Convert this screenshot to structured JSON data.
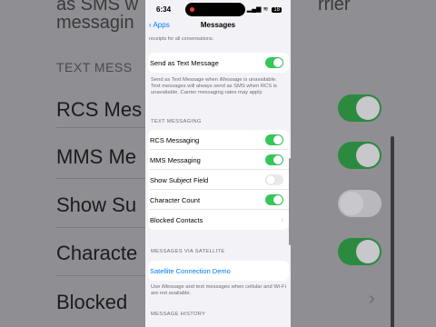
{
  "status_bar": {
    "time": "6:34",
    "signal": "▂▄▆",
    "wifi": "≋",
    "battery": "18"
  },
  "nav": {
    "back_label": "Apps",
    "title": "Messages"
  },
  "top_note": "receipts for all conversations.",
  "send_as_text": {
    "label": "Send as Text Message",
    "on": true
  },
  "send_as_text_footnote": "Send as Text Message when iMessage is unavailable. Text messages will always send as SMS when RCS is unavailable. Carrier messaging rates may apply.",
  "text_messaging_header": "TEXT MESSAGING",
  "text_messaging_rows": [
    {
      "label": "RCS Messaging",
      "on": true
    },
    {
      "label": "MMS Messaging",
      "on": true
    },
    {
      "label": "Show Subject Field",
      "on": false
    },
    {
      "label": "Character Count",
      "on": true
    },
    {
      "label": "Blocked Contacts"
    }
  ],
  "satellite_header": "MESSAGES VIA SATELLITE",
  "satellite_link": "Satellite Connection Demo",
  "satellite_footnote": "Use iMessage and text messages when cellular and Wi-Fi are not available.",
  "message_history_header": "MESSAGE HISTORY",
  "background_zoom": {
    "left": {
      "top_text_1": "as SMS w",
      "top_text_2": "messagin",
      "header": "TEXT MESS",
      "rows": [
        "RCS Mes",
        "MMS Me",
        "Show Su",
        "Characte",
        "Blocked"
      ]
    },
    "right": {
      "top_text_1": "rrier"
    }
  }
}
